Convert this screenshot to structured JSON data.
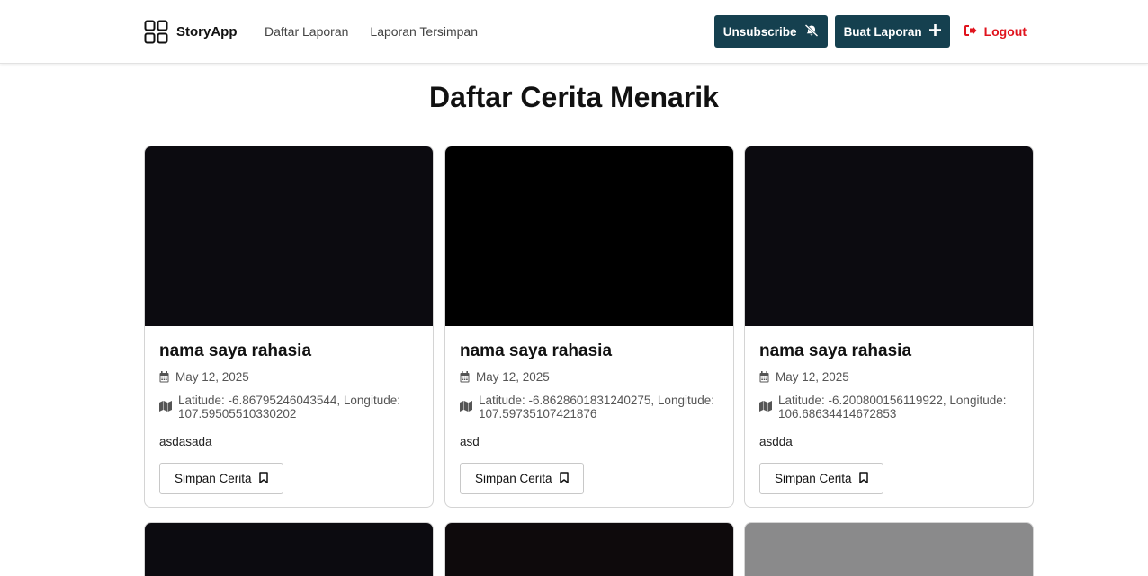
{
  "app": {
    "brand": "StoryApp",
    "nav": [
      "Daftar Laporan",
      "Laporan Tersimpan"
    ],
    "actions": {
      "unsubscribe": "Unsubscribe",
      "create": "Buat Laporan",
      "logout": "Logout"
    }
  },
  "page": {
    "title": "Daftar Cerita Menarik"
  },
  "stories": [
    {
      "name": "nama saya rahasia",
      "date": "May 12, 2025",
      "location": "Latitude: -6.86795246043544, Longitude: 107.59505510330202",
      "description": "asdasada",
      "save_label": "Simpan Cerita",
      "image_color": "#0c0b10"
    },
    {
      "name": "nama saya rahasia",
      "date": "May 12, 2025",
      "location": "Latitude: -6.8628601831240275, Longitude: 107.59735107421876",
      "description": "asd",
      "save_label": "Simpan Cerita",
      "image_color": "#000000"
    },
    {
      "name": "nama saya rahasia",
      "date": "May 12, 2025",
      "location": "Latitude: -6.200800156119922, Longitude: 106.68634414672853",
      "description": "asdda",
      "save_label": "Simpan Cerita",
      "image_color": "#0c0b10"
    }
  ],
  "next_row_images": [
    "#0c0b10",
    "#0e0a0c",
    "#8a8a8b"
  ],
  "colors": {
    "primary": "#15404f",
    "logout": "#e0141e"
  },
  "icons": {
    "brand": "grid-icon",
    "unsubscribe": "bell-slash-icon",
    "create": "plus-icon",
    "logout": "sign-out-icon",
    "date": "calendar-icon",
    "location": "map-icon",
    "save": "bookmark-icon"
  }
}
